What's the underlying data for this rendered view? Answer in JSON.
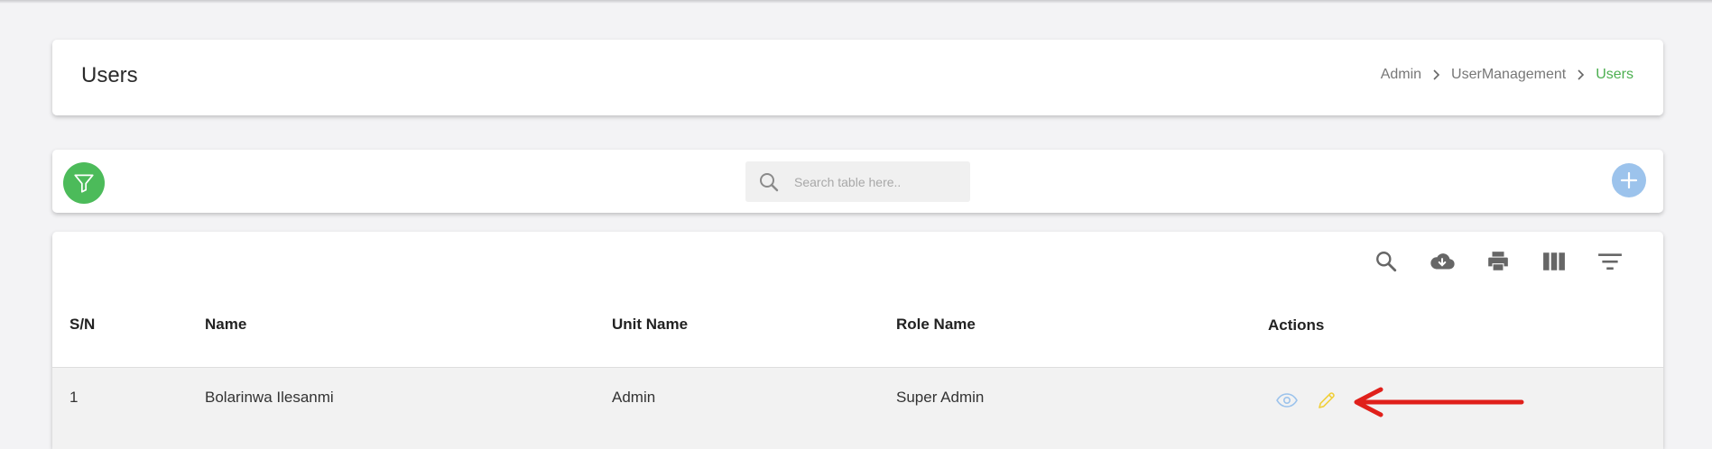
{
  "header": {
    "title": "Users",
    "breadcrumb": [
      "Admin",
      "UserManagement",
      "Users"
    ]
  },
  "toolbar": {
    "filter_icon": "filter-icon",
    "search": {
      "placeholder": "Search table here..",
      "icon": "search-icon"
    },
    "add_icon": "plus-icon",
    "colors": {
      "filter": "#4cbb5a",
      "add": "#9cc3ec",
      "accent": "#4caf50"
    }
  },
  "table": {
    "tools": [
      "search-icon",
      "cloud-download-icon",
      "print-icon",
      "view-column-icon",
      "filter-list-icon"
    ],
    "columns": [
      "S/N",
      "Name",
      "Unit Name",
      "Role Name",
      "Actions"
    ],
    "rows": [
      {
        "sn": "1",
        "name": "Bolarinwa Ilesanmi",
        "unit": "Admin",
        "role": "Super Admin",
        "actions": [
          "eye-icon",
          "pencil-icon"
        ]
      }
    ]
  },
  "annotation": {
    "arrow_color": "#e0201b"
  }
}
